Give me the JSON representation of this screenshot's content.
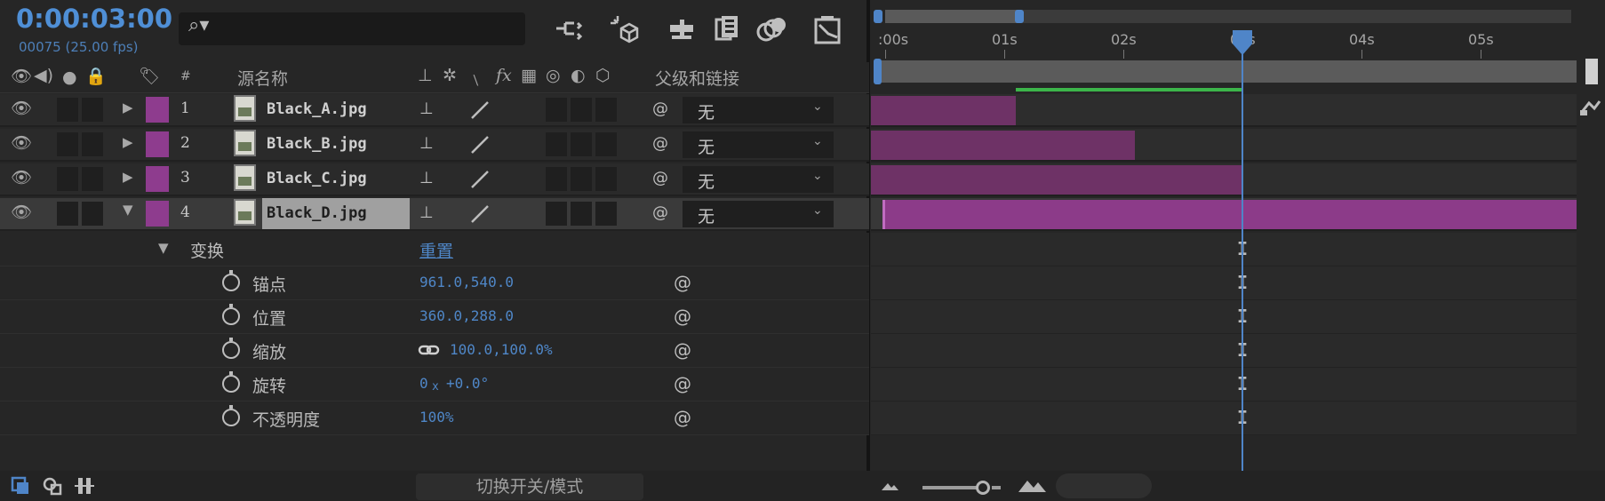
{
  "header": {
    "timecode": "0:00:03:00",
    "frames": "00075 (25.00 fps)",
    "search_glyph": "⌕▾"
  },
  "columns": {
    "source_name": "源名称",
    "hash": "#",
    "parent_link": "父级和链接",
    "fx": "fx"
  },
  "layers": [
    {
      "number": "1",
      "name": "Black_A.jpg",
      "parent": "无",
      "expanded": false,
      "selected": false
    },
    {
      "number": "2",
      "name": "Black_B.jpg",
      "parent": "无",
      "expanded": false,
      "selected": false
    },
    {
      "number": "3",
      "name": "Black_C.jpg",
      "parent": "无",
      "expanded": false,
      "selected": false
    },
    {
      "number": "4",
      "name": "Black_D.jpg",
      "parent": "无",
      "expanded": true,
      "selected": true
    }
  ],
  "transform": {
    "label": "变换",
    "reset": "重置",
    "properties": [
      {
        "label": "锚点",
        "value": "961.0,540.0"
      },
      {
        "label": "位置",
        "value": "360.0,288.0"
      },
      {
        "label": "缩放",
        "value": "100.0,100.0%"
      },
      {
        "label": "旋转",
        "value_prefix": "0",
        "value_x": "x",
        "value": "+0.0°"
      },
      {
        "label": "不透明度",
        "value": "100%"
      }
    ]
  },
  "timeline": {
    "ticks": [
      ":00s",
      "01s",
      "02s",
      "03s",
      "04s",
      "05s"
    ],
    "playhead_seconds": 3,
    "layer_bars_end_seconds": [
      1.1,
      2.1,
      3.0,
      6.0
    ],
    "selected_color": "#8c3b89",
    "bar_color": "#6e3266",
    "accent": "#4f85c8",
    "green_range_seconds": [
      1.1,
      3.0
    ]
  },
  "footer": {
    "toggle_label": "切换开关/模式"
  }
}
